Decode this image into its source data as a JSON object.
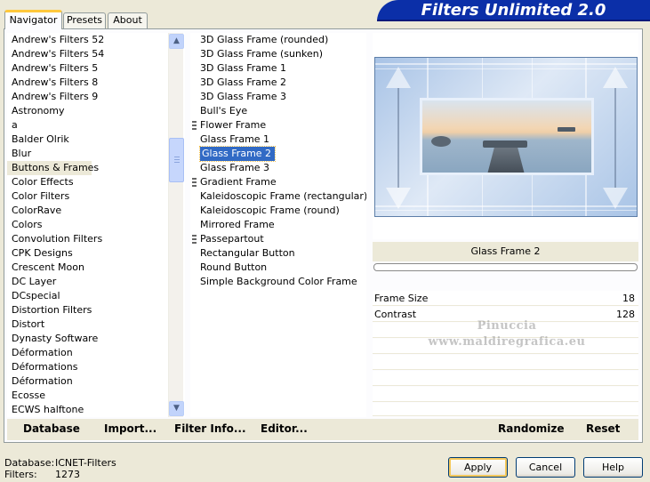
{
  "tabs": [
    {
      "label": "Navigator"
    },
    {
      "label": "Presets"
    },
    {
      "label": "About"
    }
  ],
  "banner_title": "Filters Unlimited 2.0",
  "categories": [
    "Andrew's Filters 52",
    "Andrew's Filters 54",
    "Andrew's Filters 5",
    "Andrew's Filters 8",
    "Andrew's Filters 9",
    "Astronomy",
    "a",
    "Balder Olrik",
    "Blur",
    "Buttons & Frames",
    "Color Effects",
    "Color Filters",
    "ColorRave",
    "Colors",
    "Convolution Filters",
    "CPK Designs",
    "Crescent Moon",
    "DC Layer",
    "DCspecial",
    "Distortion Filters",
    "Distort",
    "Dynasty Software",
    "Déformation",
    "Déformations",
    "Déformation",
    "Ecosse",
    "ECWS halftone"
  ],
  "selected_category": "Buttons & Frames",
  "filters": [
    {
      "label": "3D Glass Frame (rounded)",
      "folder": false
    },
    {
      "label": "3D Glass Frame (sunken)",
      "folder": false
    },
    {
      "label": "3D Glass Frame 1",
      "folder": false
    },
    {
      "label": "3D Glass Frame 2",
      "folder": false
    },
    {
      "label": "3D Glass Frame 3",
      "folder": false
    },
    {
      "label": "Bull's Eye",
      "folder": false
    },
    {
      "label": "Flower Frame",
      "folder": true
    },
    {
      "label": "Glass Frame 1",
      "folder": false
    },
    {
      "label": "Glass Frame 2",
      "folder": false
    },
    {
      "label": "Glass Frame 3",
      "folder": false
    },
    {
      "label": "Gradient Frame",
      "folder": true
    },
    {
      "label": "Kaleidoscopic Frame (rectangular)",
      "folder": false
    },
    {
      "label": "Kaleidoscopic Frame (round)",
      "folder": false
    },
    {
      "label": "Mirrored Frame",
      "folder": false
    },
    {
      "label": "Passepartout",
      "folder": true
    },
    {
      "label": "Rectangular Button",
      "folder": false
    },
    {
      "label": "Round Button",
      "folder": false
    },
    {
      "label": "Simple Background Color Frame",
      "folder": false
    }
  ],
  "selected_filter": "Glass Frame 2",
  "settings": {
    "filter_name": "Glass Frame 2",
    "params": [
      {
        "label": "Frame Size",
        "value": "18"
      },
      {
        "label": "Contrast",
        "value": "128"
      }
    ]
  },
  "watermark": {
    "line1": "Pinuccia",
    "line2": "www.maldiregrafica.eu"
  },
  "toolbar": {
    "database": "Database",
    "import": "Import...",
    "filter_info": "Filter Info...",
    "editor": "Editor...",
    "randomize": "Randomize",
    "reset": "Reset"
  },
  "status": {
    "database_label": "Database:",
    "database_value": "ICNET-Filters",
    "filters_label": "Filters:",
    "filters_value": "1273"
  },
  "buttons": {
    "apply": "Apply",
    "cancel": "Cancel",
    "help": "Help"
  },
  "colors": {
    "banner": "#0b2fa8",
    "selection": "#316ac5",
    "tab_highlight": "#ffc83c"
  }
}
